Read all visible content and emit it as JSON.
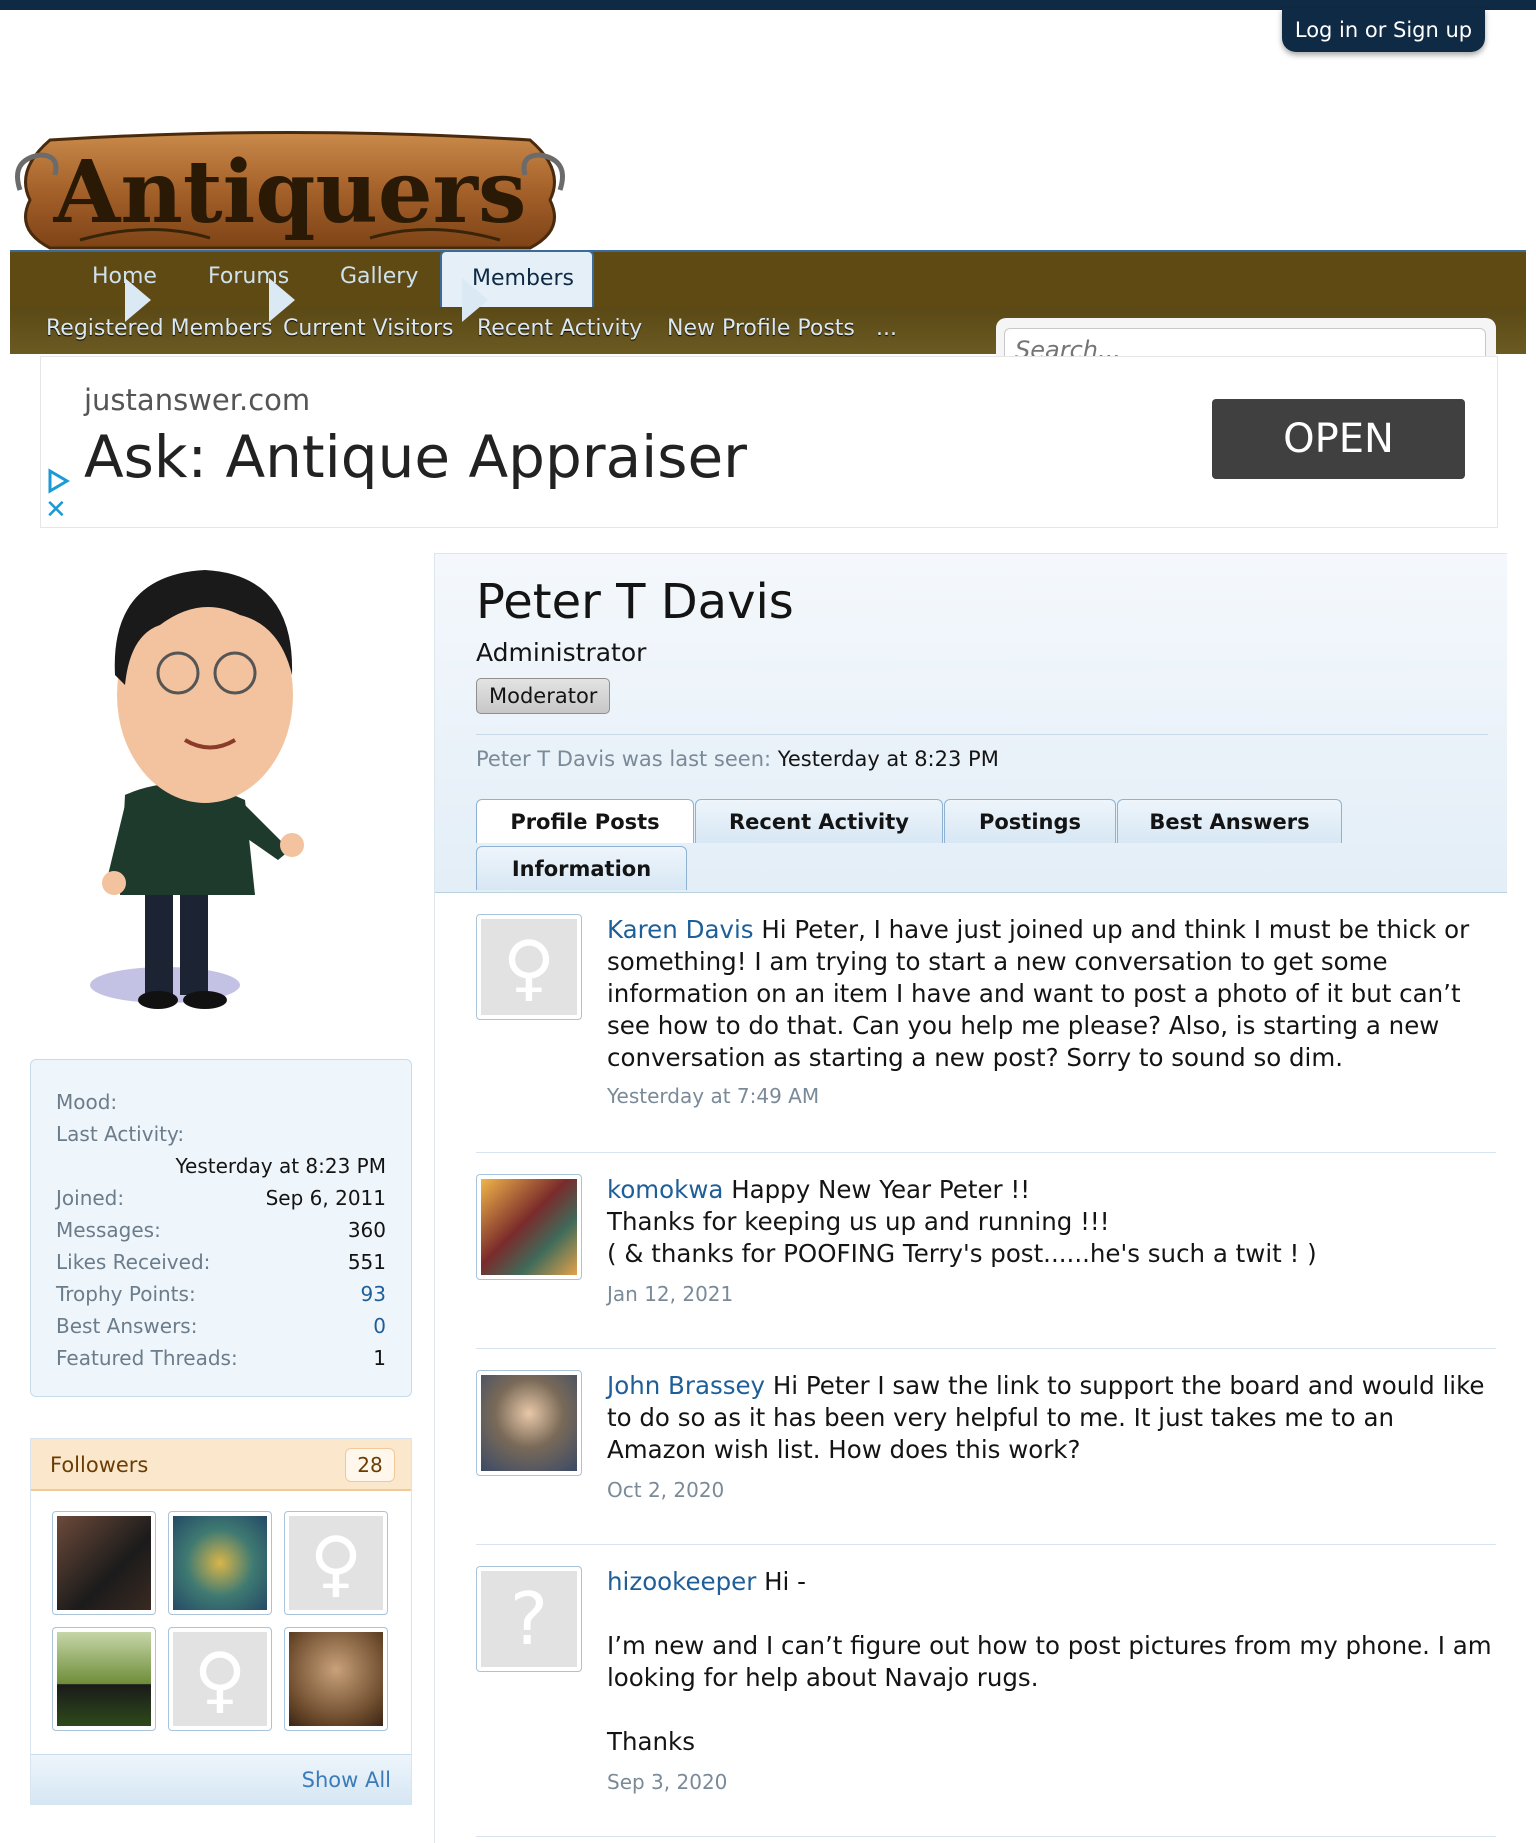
{
  "header": {
    "login_label": "Log in or Sign up",
    "logo_text": "Antiquers"
  },
  "nav": {
    "tabs": [
      "Home",
      "Forums",
      "Gallery",
      "Members"
    ],
    "subtabs": [
      "Registered Members",
      "Current Visitors",
      "Recent Activity",
      "New Profile Posts",
      "..."
    ],
    "search_placeholder": "Search..."
  },
  "ad": {
    "domain": "justanswer.com",
    "title": "Ask: Antique Appraiser",
    "button": "OPEN"
  },
  "profile": {
    "name": "Peter T Davis",
    "title": "Administrator",
    "badge": "Moderator",
    "last_seen_label": "Peter T Davis was last seen:",
    "last_seen_value": "Yesterday at 8:23 PM",
    "tabs": [
      "Profile Posts",
      "Recent Activity",
      "Postings",
      "Best Answers",
      "Information"
    ]
  },
  "stats": {
    "mood_label": "Mood:",
    "last_activity_label": "Last Activity:",
    "last_activity_value": "Yesterday at 8:23 PM",
    "joined_label": "Joined:",
    "joined_value": "Sep 6, 2011",
    "messages_label": "Messages:",
    "messages_value": "360",
    "likes_label": "Likes Received:",
    "likes_value": "551",
    "trophy_label": "Trophy Points:",
    "trophy_value": "93",
    "best_label": "Best Answers:",
    "best_value": "0",
    "featured_label": "Featured Threads:",
    "featured_value": "1"
  },
  "followers": {
    "title": "Followers",
    "count": "28",
    "show_all": "Show All"
  },
  "posts": [
    {
      "author": "Karen Davis",
      "text": " Hi Peter, I have just joined up and think I must be thick or something! I am trying to start a new conversation to get some information on an item I have and want to post a photo of it but can’t see how to do that. Can you help me please? Also, is starting a new conversation as starting a new post? Sorry to sound so dim.",
      "date": "Yesterday at 7:49 AM"
    },
    {
      "author": "komokwa",
      "text": " Happy New Year Peter !!",
      "line2": "Thanks for keeping us up and running !!!",
      "line3": "( & thanks for POOFING Terry's post......he's such a twit ! )",
      "date": "Jan 12, 2021"
    },
    {
      "author": "John Brassey",
      "text": " Hi Peter I saw the link to support the board and would like to do so as it has been very helpful to me. It just takes me to an Amazon wish list. How does this work?",
      "date": "Oct 2, 2020"
    },
    {
      "author": "hizookeeper",
      "text": " Hi -",
      "line2": "I’m new and I can’t figure out how to post pictures from my phone. I am looking for help about Navajo rugs.",
      "line3": "Thanks",
      "date": "Sep 3, 2020"
    }
  ],
  "colors": {
    "nav_bg": "#5e4a12",
    "topbar": "#0f2a44",
    "link": "#1f5f99"
  }
}
